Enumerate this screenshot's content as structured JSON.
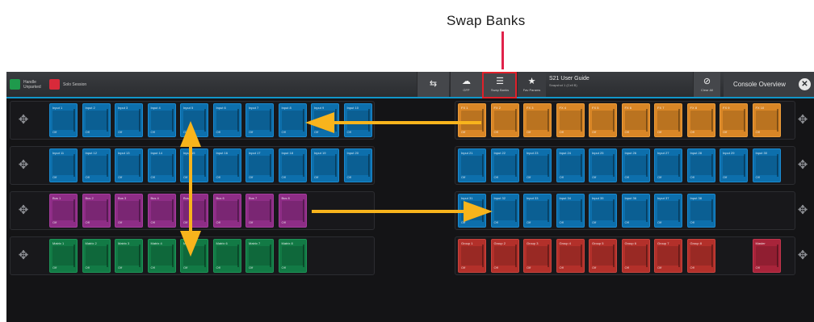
{
  "annotation": {
    "callout_label": "Swap Banks",
    "accent_color": "#e0224a",
    "arrow_color": "#f8b41c"
  },
  "topbar": {
    "left_items": [
      {
        "label": "Handle Unparked",
        "color": "#1f9a4c"
      },
      {
        "label": "Solo Session",
        "color": "#d82a3a"
      }
    ],
    "buttons": [
      {
        "icon": "network-icon",
        "glyph": "⇆",
        "label": ""
      },
      {
        "icon": "cloud-icon",
        "glyph": "☁",
        "label": "GFP"
      },
      {
        "icon": "swap-banks-icon",
        "glyph": "☰",
        "label": "Swap Banks"
      },
      {
        "icon": "star-icon",
        "glyph": "★",
        "label": "Fav Params"
      }
    ],
    "title": "S21 User Guide",
    "subtitle": "Snapshot 1 (Cell B)",
    "clear_all_label": "Clear All",
    "console_overview_label": "Console Overview",
    "close_glyph": "✕"
  },
  "left_bank": {
    "rows": [
      {
        "color": "blue",
        "labels": [
          "Input 1",
          "Input 2",
          "Input 3",
          "Input 4",
          "Input 5",
          "Input 6",
          "Input 7",
          "Input 8",
          "Input 9",
          "Input 10"
        ]
      },
      {
        "color": "blue",
        "labels": [
          "Input 11",
          "Input 12",
          "Input 13",
          "Input 14",
          "Input 15",
          "Input 16",
          "Input 17",
          "Input 18",
          "Input 19",
          "Input 20"
        ]
      },
      {
        "color": "purple",
        "labels": [
          "Bus 1",
          "Bus 2",
          "Bus 3",
          "Bus 4",
          "Bus 5",
          "Bus 6",
          "Bus 7",
          "Bus 8"
        ]
      },
      {
        "color": "green",
        "labels": [
          "Matrix 1",
          "Matrix 2",
          "Matrix 3",
          "Matrix 4",
          "Matrix 5",
          "Matrix 6",
          "Matrix 7",
          "Matrix 8"
        ]
      }
    ]
  },
  "right_bank": {
    "rows": [
      {
        "color": "orange",
        "labels": [
          "FX 1",
          "FX 2",
          "FX 3",
          "FX 4",
          "FX 5",
          "FX 6",
          "FX 7",
          "FX 8",
          "FX 9",
          "FX 10"
        ]
      },
      {
        "color": "blue",
        "labels": [
          "Input 21",
          "Input 22",
          "Input 23",
          "Input 24",
          "Input 25",
          "Input 26",
          "Input 27",
          "Input 28",
          "Input 29",
          "Input 30"
        ]
      },
      {
        "color": "blue",
        "labels": [
          "Input 31",
          "Input 32",
          "Input 33",
          "Input 34",
          "Input 35",
          "Input 36",
          "Input 37",
          "Input 38"
        ]
      },
      {
        "color": "red",
        "labels": [
          "Group 1",
          "Group 2",
          "Group 3",
          "Group 4",
          "Group 5",
          "Group 6",
          "Group 7",
          "Group 8"
        ],
        "extra": {
          "label": "Master",
          "color": "crimson"
        }
      }
    ]
  },
  "fader_value": "Off",
  "move_glyph": "✥"
}
